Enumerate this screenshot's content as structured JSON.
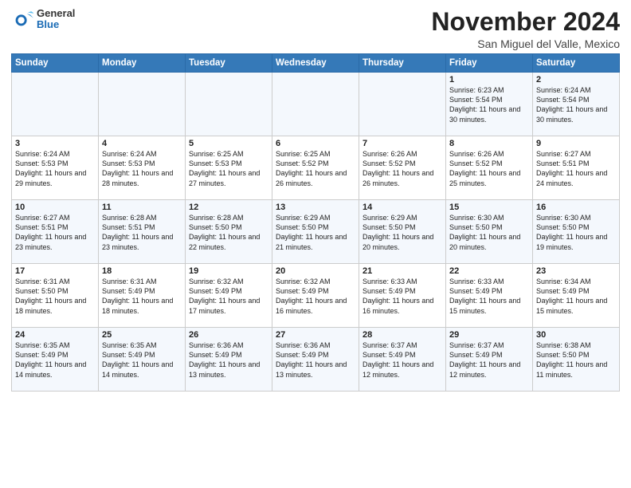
{
  "header": {
    "logo": {
      "general": "General",
      "blue": "Blue"
    },
    "title": "November 2024",
    "location": "San Miguel del Valle, Mexico"
  },
  "weekdays": [
    "Sunday",
    "Monday",
    "Tuesday",
    "Wednesday",
    "Thursday",
    "Friday",
    "Saturday"
  ],
  "weeks": [
    [
      {
        "day": "",
        "info": ""
      },
      {
        "day": "",
        "info": ""
      },
      {
        "day": "",
        "info": ""
      },
      {
        "day": "",
        "info": ""
      },
      {
        "day": "",
        "info": ""
      },
      {
        "day": "1",
        "info": "Sunrise: 6:23 AM\nSunset: 5:54 PM\nDaylight: 11 hours and 30 minutes."
      },
      {
        "day": "2",
        "info": "Sunrise: 6:24 AM\nSunset: 5:54 PM\nDaylight: 11 hours and 30 minutes."
      }
    ],
    [
      {
        "day": "3",
        "info": "Sunrise: 6:24 AM\nSunset: 5:53 PM\nDaylight: 11 hours and 29 minutes."
      },
      {
        "day": "4",
        "info": "Sunrise: 6:24 AM\nSunset: 5:53 PM\nDaylight: 11 hours and 28 minutes."
      },
      {
        "day": "5",
        "info": "Sunrise: 6:25 AM\nSunset: 5:53 PM\nDaylight: 11 hours and 27 minutes."
      },
      {
        "day": "6",
        "info": "Sunrise: 6:25 AM\nSunset: 5:52 PM\nDaylight: 11 hours and 26 minutes."
      },
      {
        "day": "7",
        "info": "Sunrise: 6:26 AM\nSunset: 5:52 PM\nDaylight: 11 hours and 26 minutes."
      },
      {
        "day": "8",
        "info": "Sunrise: 6:26 AM\nSunset: 5:52 PM\nDaylight: 11 hours and 25 minutes."
      },
      {
        "day": "9",
        "info": "Sunrise: 6:27 AM\nSunset: 5:51 PM\nDaylight: 11 hours and 24 minutes."
      }
    ],
    [
      {
        "day": "10",
        "info": "Sunrise: 6:27 AM\nSunset: 5:51 PM\nDaylight: 11 hours and 23 minutes."
      },
      {
        "day": "11",
        "info": "Sunrise: 6:28 AM\nSunset: 5:51 PM\nDaylight: 11 hours and 23 minutes."
      },
      {
        "day": "12",
        "info": "Sunrise: 6:28 AM\nSunset: 5:50 PM\nDaylight: 11 hours and 22 minutes."
      },
      {
        "day": "13",
        "info": "Sunrise: 6:29 AM\nSunset: 5:50 PM\nDaylight: 11 hours and 21 minutes."
      },
      {
        "day": "14",
        "info": "Sunrise: 6:29 AM\nSunset: 5:50 PM\nDaylight: 11 hours and 20 minutes."
      },
      {
        "day": "15",
        "info": "Sunrise: 6:30 AM\nSunset: 5:50 PM\nDaylight: 11 hours and 20 minutes."
      },
      {
        "day": "16",
        "info": "Sunrise: 6:30 AM\nSunset: 5:50 PM\nDaylight: 11 hours and 19 minutes."
      }
    ],
    [
      {
        "day": "17",
        "info": "Sunrise: 6:31 AM\nSunset: 5:50 PM\nDaylight: 11 hours and 18 minutes."
      },
      {
        "day": "18",
        "info": "Sunrise: 6:31 AM\nSunset: 5:49 PM\nDaylight: 11 hours and 18 minutes."
      },
      {
        "day": "19",
        "info": "Sunrise: 6:32 AM\nSunset: 5:49 PM\nDaylight: 11 hours and 17 minutes."
      },
      {
        "day": "20",
        "info": "Sunrise: 6:32 AM\nSunset: 5:49 PM\nDaylight: 11 hours and 16 minutes."
      },
      {
        "day": "21",
        "info": "Sunrise: 6:33 AM\nSunset: 5:49 PM\nDaylight: 11 hours and 16 minutes."
      },
      {
        "day": "22",
        "info": "Sunrise: 6:33 AM\nSunset: 5:49 PM\nDaylight: 11 hours and 15 minutes."
      },
      {
        "day": "23",
        "info": "Sunrise: 6:34 AM\nSunset: 5:49 PM\nDaylight: 11 hours and 15 minutes."
      }
    ],
    [
      {
        "day": "24",
        "info": "Sunrise: 6:35 AM\nSunset: 5:49 PM\nDaylight: 11 hours and 14 minutes."
      },
      {
        "day": "25",
        "info": "Sunrise: 6:35 AM\nSunset: 5:49 PM\nDaylight: 11 hours and 14 minutes."
      },
      {
        "day": "26",
        "info": "Sunrise: 6:36 AM\nSunset: 5:49 PM\nDaylight: 11 hours and 13 minutes."
      },
      {
        "day": "27",
        "info": "Sunrise: 6:36 AM\nSunset: 5:49 PM\nDaylight: 11 hours and 13 minutes."
      },
      {
        "day": "28",
        "info": "Sunrise: 6:37 AM\nSunset: 5:49 PM\nDaylight: 11 hours and 12 minutes."
      },
      {
        "day": "29",
        "info": "Sunrise: 6:37 AM\nSunset: 5:49 PM\nDaylight: 11 hours and 12 minutes."
      },
      {
        "day": "30",
        "info": "Sunrise: 6:38 AM\nSunset: 5:50 PM\nDaylight: 11 hours and 11 minutes."
      }
    ]
  ]
}
